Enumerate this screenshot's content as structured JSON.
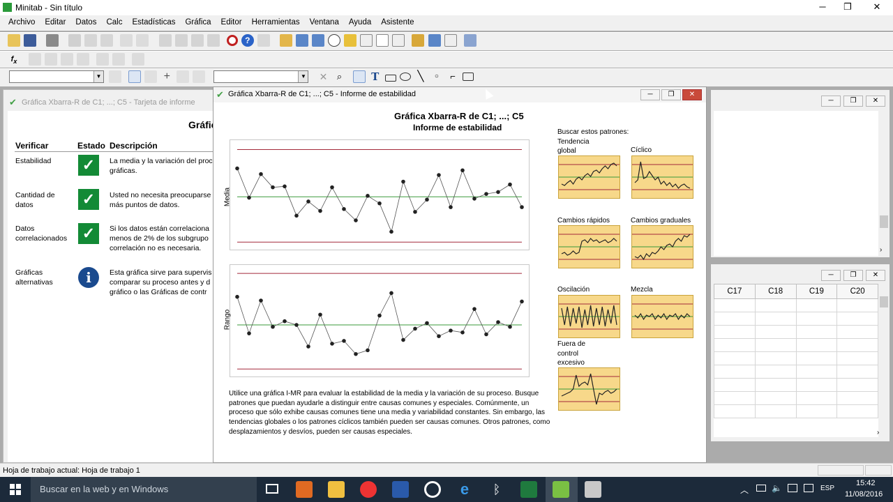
{
  "app": {
    "title": "Minitab - Sin título"
  },
  "menu": [
    "Archivo",
    "Editar",
    "Datos",
    "Calc",
    "Estadísticas",
    "Gráfica",
    "Editor",
    "Herramientas",
    "Ventana",
    "Ayuda",
    "Asistente"
  ],
  "card_window": {
    "title": "Gráfica Xbarra-R de C1; ...; C5 - Tarjeta de informe",
    "heading": "Gráfic",
    "columns": {
      "check": "Verificar",
      "status": "Estado",
      "desc": "Descripción"
    },
    "rows": [
      {
        "check": "Estabilidad",
        "status": "check",
        "desc": "La media y la variación del proc gráficas."
      },
      {
        "check": "Cantidad de datos",
        "status": "check",
        "desc": "Usted no necesita preocuparse más puntos de datos."
      },
      {
        "check": "Datos correlacionados",
        "status": "check",
        "desc": "Si los datos están correlaciona menos de 2% de los subgrupo correlación no es necesaria."
      },
      {
        "check": "Gráficas alternativas",
        "status": "info",
        "desc": "Esta gráfica sirve para supervis comparar su proceso antes y d gráfico o las Gráficas de contr"
      }
    ]
  },
  "report_window": {
    "title": "Gráfica Xbarra-R de C1; ...; C5 - Informe de estabilidad",
    "heading": "Gráfica Xbarra-R de C1; ...; C5",
    "subheading": "Informe de estabilidad",
    "chart_labels": {
      "mean": "Media",
      "range": "Rango"
    },
    "patterns_title": "Buscar estos patrones:",
    "patterns": [
      "Tendencia global",
      "Cíclico",
      "Cambios rápidos",
      "Cambios graduales",
      "Oscilación",
      "Mezcla",
      "Fuera de control excesivo"
    ],
    "footnote": "Utilice una gráfica I-MR para evaluar la estabilidad de la media y la variación de su proceso. Busque patrones que puedan ayudarle a distinguir entre causas comunes y especiales. Comúnmente, un proceso que sólo exhibe causas comunes tiene una media y variabilidad constantes. Sin embargo, las tendencias globales o los patrones cíclicos también pueden ser causas comunes. Otros patrones, como desplazamientos y desvíos, pueden ser causas especiales."
  },
  "chart_data": [
    {
      "type": "line",
      "name": "Media",
      "x": [
        1,
        2,
        3,
        4,
        5,
        6,
        7,
        8,
        9,
        10,
        11,
        12,
        13,
        14,
        15,
        16,
        17,
        18,
        19,
        20,
        21,
        22,
        23,
        24,
        25
      ],
      "values": [
        0.78,
        0.47,
        0.72,
        0.58,
        0.59,
        0.28,
        0.43,
        0.33,
        0.58,
        0.35,
        0.23,
        0.49,
        0.41,
        0.11,
        0.64,
        0.32,
        0.45,
        0.71,
        0.37,
        0.76,
        0.46,
        0.51,
        0.53,
        0.61,
        0.37
      ],
      "center": 0.48,
      "ucl": 0.98,
      "lcl": 0.0,
      "ylim": [
        -0.05,
        1.05
      ]
    },
    {
      "type": "line",
      "name": "Rango",
      "x": [
        1,
        2,
        3,
        4,
        5,
        6,
        7,
        8,
        9,
        10,
        11,
        12,
        13,
        14,
        15,
        16,
        17,
        18,
        19,
        20,
        21,
        22,
        23,
        24,
        25
      ],
      "values": [
        0.77,
        0.38,
        0.73,
        0.45,
        0.51,
        0.47,
        0.24,
        0.58,
        0.27,
        0.3,
        0.16,
        0.2,
        0.57,
        0.81,
        0.31,
        0.43,
        0.49,
        0.35,
        0.41,
        0.39,
        0.64,
        0.37,
        0.5,
        0.45,
        0.72
      ],
      "center": 0.47,
      "ucl": 1.02,
      "lcl": 0.0,
      "ylim": [
        -0.05,
        1.08
      ]
    }
  ],
  "data_window": {
    "columns": [
      "C17",
      "C18",
      "C19",
      "C20"
    ]
  },
  "status_bar": {
    "text": "Hoja de trabajo actual: Hoja de trabajo 1"
  },
  "taskbar": {
    "search": "Buscar en la web y en Windows",
    "lang": "ESP",
    "time": "15:42",
    "date": "11/08/2016"
  }
}
